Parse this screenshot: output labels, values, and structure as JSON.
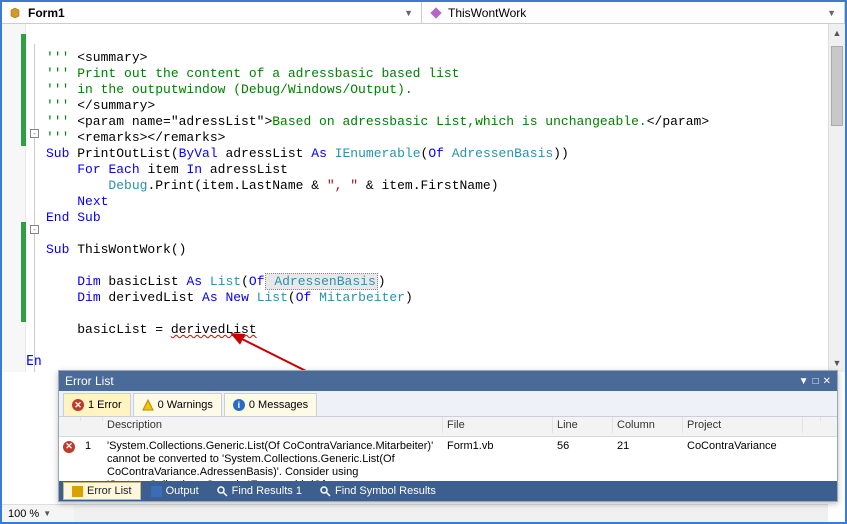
{
  "tabs": {
    "form": "Form1",
    "method": "ThisWontWork"
  },
  "code": {
    "c1": "'''",
    "c1b": " <summary>",
    "c2": "'''",
    "c2b": " Print out the content of a adressbasic based list",
    "c3": "'''",
    "c3b": " in the outputwindow (Debug/Windows/Output).",
    "c4": "'''",
    "c4b": " </summary>",
    "c5": "'''",
    "c5b": " <param name=\"adressList\">",
    "c5c": "Based on adressbasic List,which is unchangeable.",
    "c5d": "</param>",
    "c6": "'''",
    "c6b": " <remarks></remarks>",
    "l7a": "Sub",
    "l7b": " PrintOutList(",
    "l7c": "ByVal",
    "l7d": " adressList ",
    "l7e": "As",
    "l7f": " ",
    "l7g": "IEnumerable",
    "l7h": "(",
    "l7i": "Of",
    "l7j": " ",
    "l7k": "AdressenBasis",
    "l7l": "))",
    "l8a": "For",
    "l8b": " ",
    "l8c": "Each",
    "l8d": " item ",
    "l8e": "In",
    "l8f": " adressList",
    "l9a": "Debug",
    "l9b": ".Print(item.LastName & ",
    "l9c": "\", \"",
    "l9d": " & item.FirstName)",
    "l10": "Next",
    "l11a": "End",
    "l11b": " ",
    "l11c": "Sub",
    "l13a": "Sub",
    "l13b": " ThisWontWork()",
    "l15a": "Dim",
    "l15b": " basicList ",
    "l15c": "As",
    "l15d": " ",
    "l15e": "List",
    "l15f": "(",
    "l15g": "Of",
    "l15h": " ",
    "l15i": "AdressenBasis",
    "l15j": ")",
    "l16a": "Dim",
    "l16b": " derivedList ",
    "l16c": "As",
    "l16d": " ",
    "l16e": "New",
    "l16f": " ",
    "l16g": "List",
    "l16h": "(",
    "l16i": "Of",
    "l16j": " ",
    "l16k": "Mitarbeiter",
    "l16l": ")",
    "l18a": "basicList = ",
    "l18b": "derivedList",
    "lEnd": "En"
  },
  "zoom": "100 %",
  "errorlist": {
    "title": "Error List",
    "tab_error": "1 Error",
    "tab_warn": "0 Warnings",
    "tab_msg": "0 Messages",
    "headers": {
      "desc": "Description",
      "file": "File",
      "line": "Line",
      "col": "Column",
      "proj": "Project"
    },
    "row": {
      "num": "1",
      "desc": "'System.Collections.Generic.List(Of CoContraVariance.Mitarbeiter)' cannot be converted to 'System.Collections.Generic.List(Of CoContraVariance.AdressenBasis)'. Consider using 'System.Collections.Generic.IEnumerable(Of CoContraVariance.AdressenBasis)' instead.",
      "file": "Form1.vb",
      "line": "56",
      "col": "21",
      "proj": "CoContraVariance"
    },
    "bottom": {
      "errlist": "Error List",
      "output": "Output",
      "find1": "Find Results 1",
      "findsym": "Find Symbol Results"
    }
  }
}
